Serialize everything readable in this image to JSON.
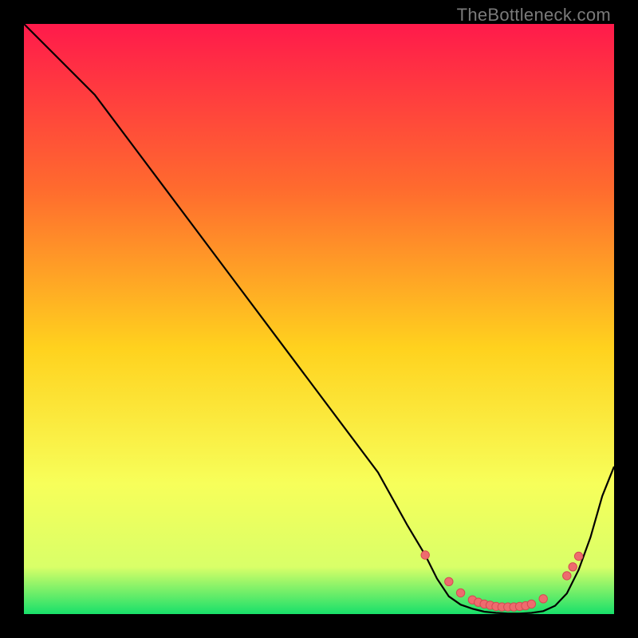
{
  "watermark": "TheBottleneck.com",
  "colors": {
    "gradient_top": "#ff1a4b",
    "gradient_mid1": "#ff6b2e",
    "gradient_mid2": "#ffd21e",
    "gradient_mid3": "#f7ff5a",
    "gradient_mid4": "#d9ff68",
    "gradient_bottom": "#18e06a",
    "line": "#000000",
    "dot_fill": "#ee6b6e",
    "dot_stroke": "#d44a52",
    "frame": "#000000"
  },
  "chart_data": {
    "type": "line",
    "title": "",
    "xlabel": "",
    "ylabel": "",
    "xlim": [
      0,
      100
    ],
    "ylim": [
      0,
      100
    ],
    "series": [
      {
        "name": "curve",
        "x": [
          0,
          6,
          12,
          18,
          24,
          30,
          36,
          42,
          48,
          54,
          60,
          65,
          68,
          70,
          72,
          74,
          76,
          78,
          80,
          82,
          84,
          86,
          88,
          90,
          92,
          94,
          96,
          98,
          100
        ],
        "y": [
          100,
          94,
          88,
          80,
          72,
          64,
          56,
          48,
          40,
          32,
          24,
          15,
          10,
          6,
          3,
          1.6,
          0.9,
          0.4,
          0.2,
          0.1,
          0.1,
          0.2,
          0.5,
          1.4,
          3.5,
          7.5,
          13,
          20,
          25
        ]
      }
    ],
    "markers": {
      "name": "highlight-dots",
      "x": [
        68,
        72,
        74,
        76,
        77,
        78,
        79,
        80,
        81,
        82,
        83,
        84,
        85,
        86,
        88,
        92,
        93,
        94
      ],
      "y": [
        10,
        5.5,
        3.6,
        2.4,
        2.0,
        1.7,
        1.5,
        1.3,
        1.2,
        1.2,
        1.2,
        1.3,
        1.4,
        1.7,
        2.6,
        6.5,
        8.0,
        9.8
      ]
    }
  }
}
